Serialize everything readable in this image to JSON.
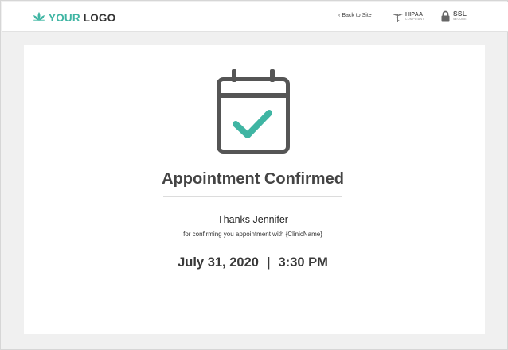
{
  "header": {
    "logo": {
      "your": "YOUR",
      "logo": "LOGO"
    },
    "back_link": "Back to Site",
    "back_icon": "chevron-left-icon",
    "hipaa": {
      "main": "HIPAA",
      "sub": "COMPLIANT"
    },
    "ssl": {
      "main": "SSL",
      "sub": "SECURE"
    }
  },
  "confirmation": {
    "icon": "calendar-check-icon",
    "title": "Appointment Confirmed",
    "thanks": "Thanks Jennifer",
    "message": "for confirming you appointment with {ClinicName}",
    "date": "July 31, 2020",
    "separator": "|",
    "time": "3:30 PM"
  },
  "colors": {
    "accent": "#3fb5a3",
    "icon_gray": "#555555",
    "text_dark": "#444444"
  }
}
